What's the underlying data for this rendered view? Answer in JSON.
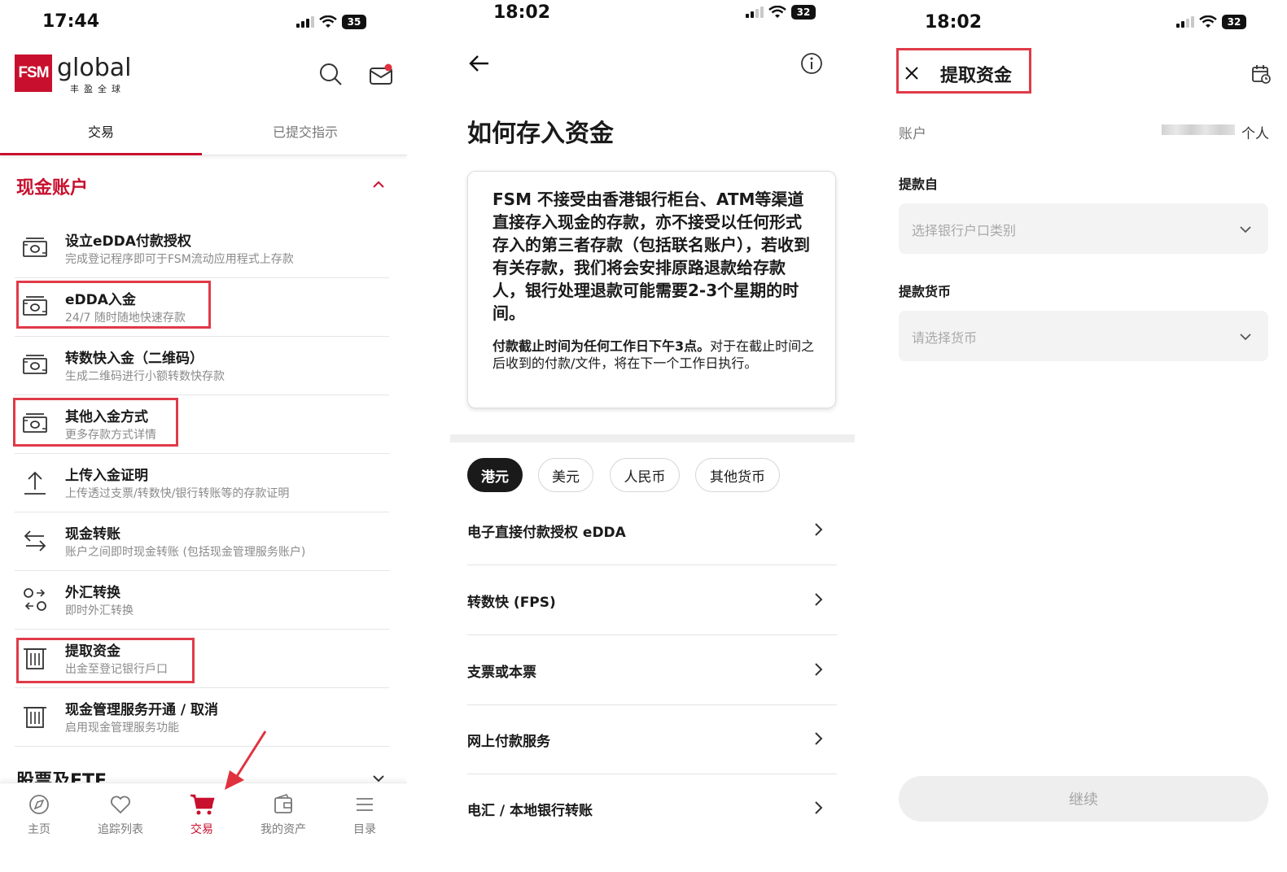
{
  "colors": {
    "brand": "#c8102e",
    "highlight": "#e03a48",
    "muted": "#8a8a8a"
  },
  "left_screen": {
    "status_time": "17:44",
    "battery": "35",
    "logo": {
      "box": "FSM",
      "word": "global",
      "sub": "丰盈全球"
    },
    "header_icons": [
      "search-icon",
      "mail-icon"
    ],
    "tabs": [
      "交易",
      "已提交指示"
    ],
    "section_title": "现金账户",
    "menu": [
      {
        "title": "设立eDDA付款授权",
        "subtitle": "完成登记程序即可于FSM流动应用程式上存款",
        "icon": "cash-icon"
      },
      {
        "title": "eDDA入金",
        "subtitle": "24/7 随时随地快速存款",
        "icon": "cash-icon"
      },
      {
        "title": "转数快入金（二维码）",
        "subtitle": "生成二维码进行小额转数快存款",
        "icon": "cash-icon"
      },
      {
        "title": "其他入金方式",
        "subtitle": "更多存款方式详情",
        "icon": "cash-icon"
      },
      {
        "title": "上传入金证明",
        "subtitle": "上传透过支票/转数快/银行转账等的存款证明",
        "icon": "upload-icon"
      },
      {
        "title": "现金转账",
        "subtitle": "账户之间即时现金转账 (包括现金管理服务账户)",
        "icon": "transfer-icon"
      },
      {
        "title": "外汇转换",
        "subtitle": "即时外汇转换",
        "icon": "fx-convert-icon"
      },
      {
        "title": "提取资金",
        "subtitle": "出金至登记银行戶口",
        "icon": "bank-icon"
      },
      {
        "title": "现金管理服务开通 / 取消",
        "subtitle": "启用现金管理服务功能",
        "icon": "bank-icon"
      }
    ],
    "next_section": "股票及ETF",
    "bottom_nav": [
      {
        "label": "主页",
        "icon": "home-icon"
      },
      {
        "label": "追踪列表",
        "icon": "heart-icon"
      },
      {
        "label": "交易",
        "icon": "cart-icon"
      },
      {
        "label": "我的资产",
        "icon": "wallet-icon"
      },
      {
        "label": "目录",
        "icon": "menu-icon"
      }
    ]
  },
  "middle_screen": {
    "status_time": "18:02",
    "battery": "32",
    "title": "如何存入资金",
    "notice_main": "FSM 不接受由香港银行柜台、ATM等渠道直接存入现金的存款，亦不接受以任何形式存入的第三者存款（包括联名账户），若收到有关存款，我们将会安排原路退款给存款人，银行处理退款可能需要2-3个星期的时间。",
    "notice_cutoff_bold": "付款截止时间为任何工作日下午3点。",
    "notice_cutoff_rest": "对于在截止时间之后收到的付款/文件，将在下一个工作日执行。",
    "currency_chips": [
      "港元",
      "美元",
      "人民币",
      "其他货币"
    ],
    "methods": [
      "电子直接付款授权 eDDA",
      "转数快 (FPS)",
      "支票或本票",
      "网上付款服务",
      "电汇 / 本地银行转账"
    ]
  },
  "right_screen": {
    "status_time": "18:02",
    "battery": "32",
    "title": "提取资金",
    "account_label": "账户",
    "account_value": "个人",
    "withdraw_from_label": "提款自",
    "withdraw_from_placeholder": "选择银行户口类别",
    "currency_label": "提款货币",
    "currency_placeholder": "请选择货币",
    "continue": "继续"
  }
}
